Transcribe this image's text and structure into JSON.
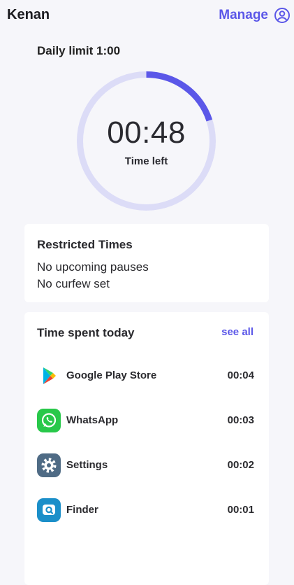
{
  "header": {
    "user_name": "Kenan",
    "manage_label": "Manage",
    "account_icon": "account-circle-icon"
  },
  "daily_limit": {
    "title": "Daily limit 1:00",
    "time_left_value": "00:48",
    "time_left_caption": "Time left",
    "used_fraction": 0.2,
    "colors": {
      "track": "#dcdcf7",
      "progress": "#5b57e8"
    }
  },
  "restricted_times": {
    "title": "Restricted Times",
    "lines": [
      "No upcoming pauses",
      "No curfew set"
    ]
  },
  "time_spent": {
    "title": "Time spent today",
    "see_all_label": "see all",
    "apps": [
      {
        "name": "Google Play Store",
        "time": "00:04",
        "icon": "google-play-icon"
      },
      {
        "name": "WhatsApp",
        "time": "00:03",
        "icon": "whatsapp-icon"
      },
      {
        "name": "Settings",
        "time": "00:02",
        "icon": "settings-gear-icon"
      },
      {
        "name": "Finder",
        "time": "00:01",
        "icon": "finder-icon"
      }
    ]
  },
  "colors": {
    "accent": "#5b57e8",
    "background": "#f6f6fa"
  }
}
